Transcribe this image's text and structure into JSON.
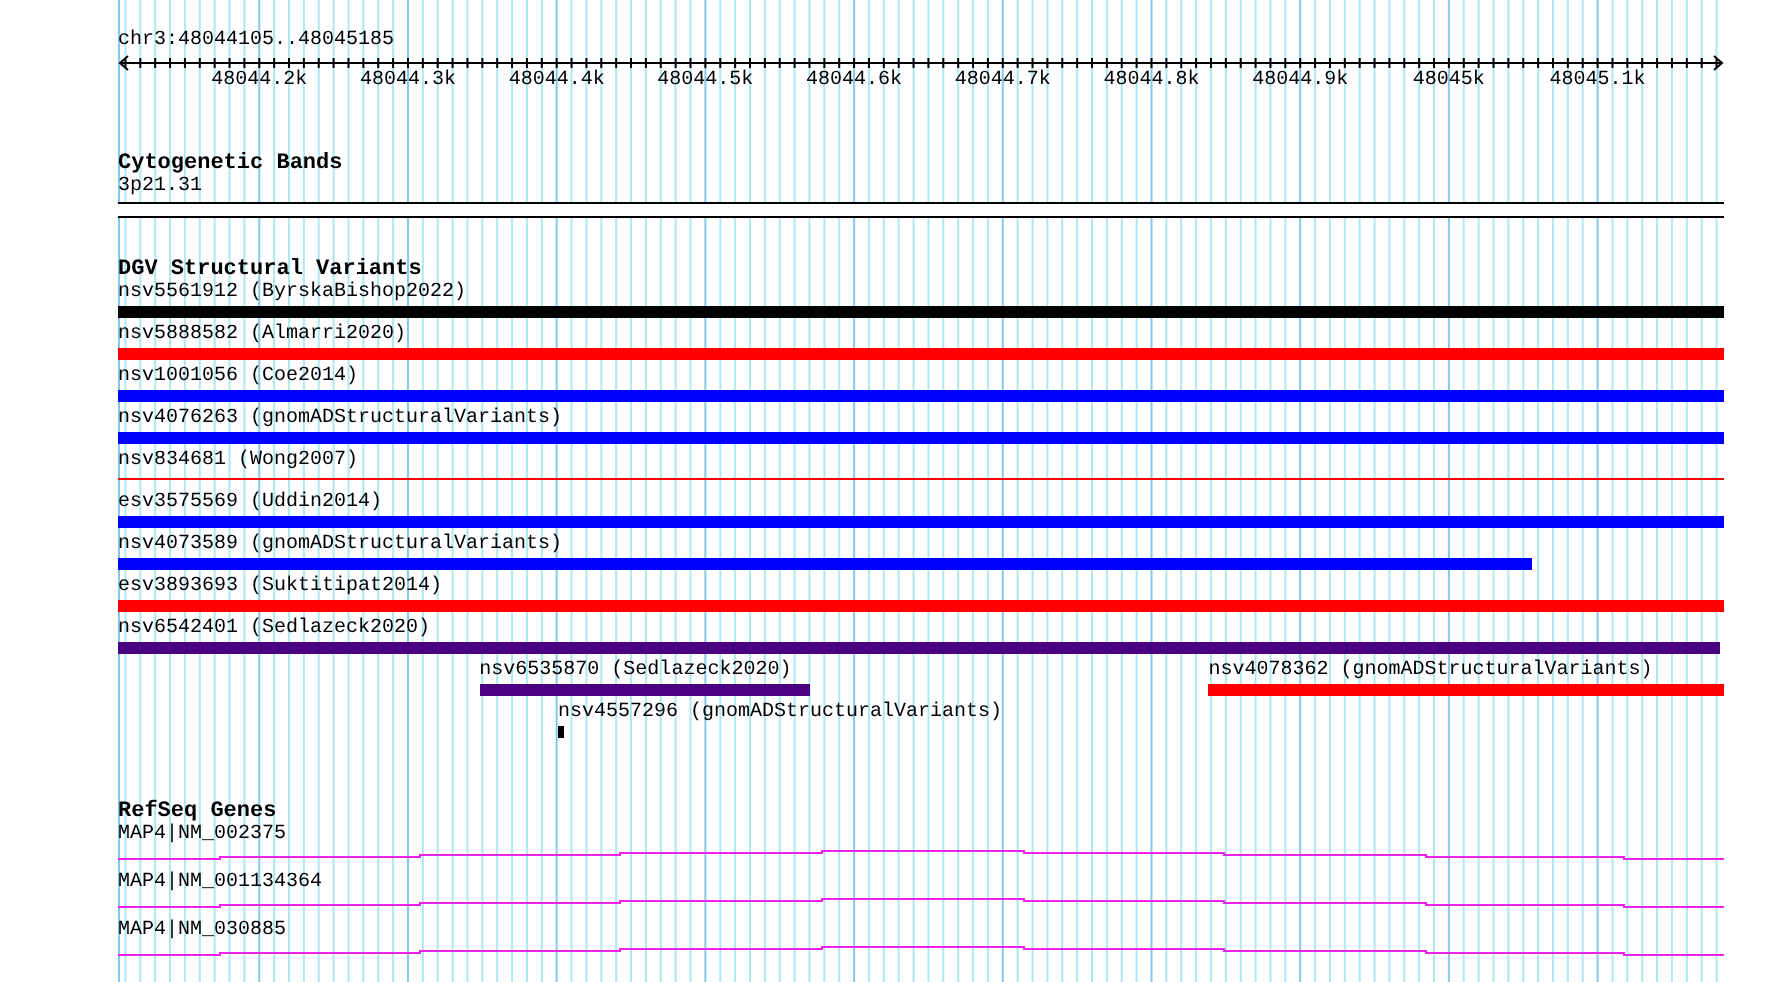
{
  "location": "chr3:48044105..48045185",
  "ruler": {
    "ticks": [
      "48044.2k",
      "48044.3k",
      "48044.4k",
      "48044.5k",
      "48044.6k",
      "48044.7k",
      "48044.8k",
      "48044.9k",
      "48045k",
      "48045.1k"
    ]
  },
  "tracks": [
    {
      "kind": "cytoband",
      "title": "Cytogenetic Bands",
      "bands": [
        "3p21.31"
      ]
    },
    {
      "kind": "variants",
      "title": "DGV Structural Variants",
      "features": [
        {
          "label": "nsv5561912 (ByrskaBishop2022)",
          "color": "#000000",
          "kind": "bar"
        },
        {
          "label": "nsv5888582 (Almarri2020)",
          "color": "#ff0000",
          "kind": "bar"
        },
        {
          "label": "nsv1001056 (Coe2014)",
          "color": "#0000ff",
          "kind": "bar"
        },
        {
          "label": "nsv4076263 (gnomADStructuralVariants)",
          "color": "#0000ff",
          "kind": "bar"
        },
        {
          "label": "nsv834681 (Wong2007)",
          "color": "#ff0000",
          "kind": "line"
        },
        {
          "label": "esv3575569 (Uddin2014)",
          "color": "#0000ff",
          "kind": "bar"
        },
        {
          "label": "nsv4073589 (gnomADStructuralVariants)",
          "color": "#0000ff",
          "kind": "bar"
        },
        {
          "label": "esv3893693 (Suktitipat2014)",
          "color": "#ff0000",
          "kind": "bar"
        },
        {
          "label": "nsv6542401 (Sedlazeck2020)",
          "color": "#4b0082",
          "kind": "bar"
        },
        {
          "label": "nsv6535870 (Sedlazeck2020)",
          "color": "#4b0082",
          "kind": "bar"
        },
        {
          "label": "nsv4078362 (gnomADStructuralVariants)",
          "color": "#ff0000",
          "kind": "bar"
        },
        {
          "label": "nsv4557296 (gnomADStructuralVariants)",
          "color": "#000000",
          "kind": "bar"
        }
      ]
    },
    {
      "kind": "genes",
      "title": "RefSeq Genes",
      "genes": [
        {
          "label": "MAP4|NM_002375"
        },
        {
          "label": "MAP4|NM_001134364"
        },
        {
          "label": "MAP4|NM_030885"
        }
      ]
    }
  ]
}
